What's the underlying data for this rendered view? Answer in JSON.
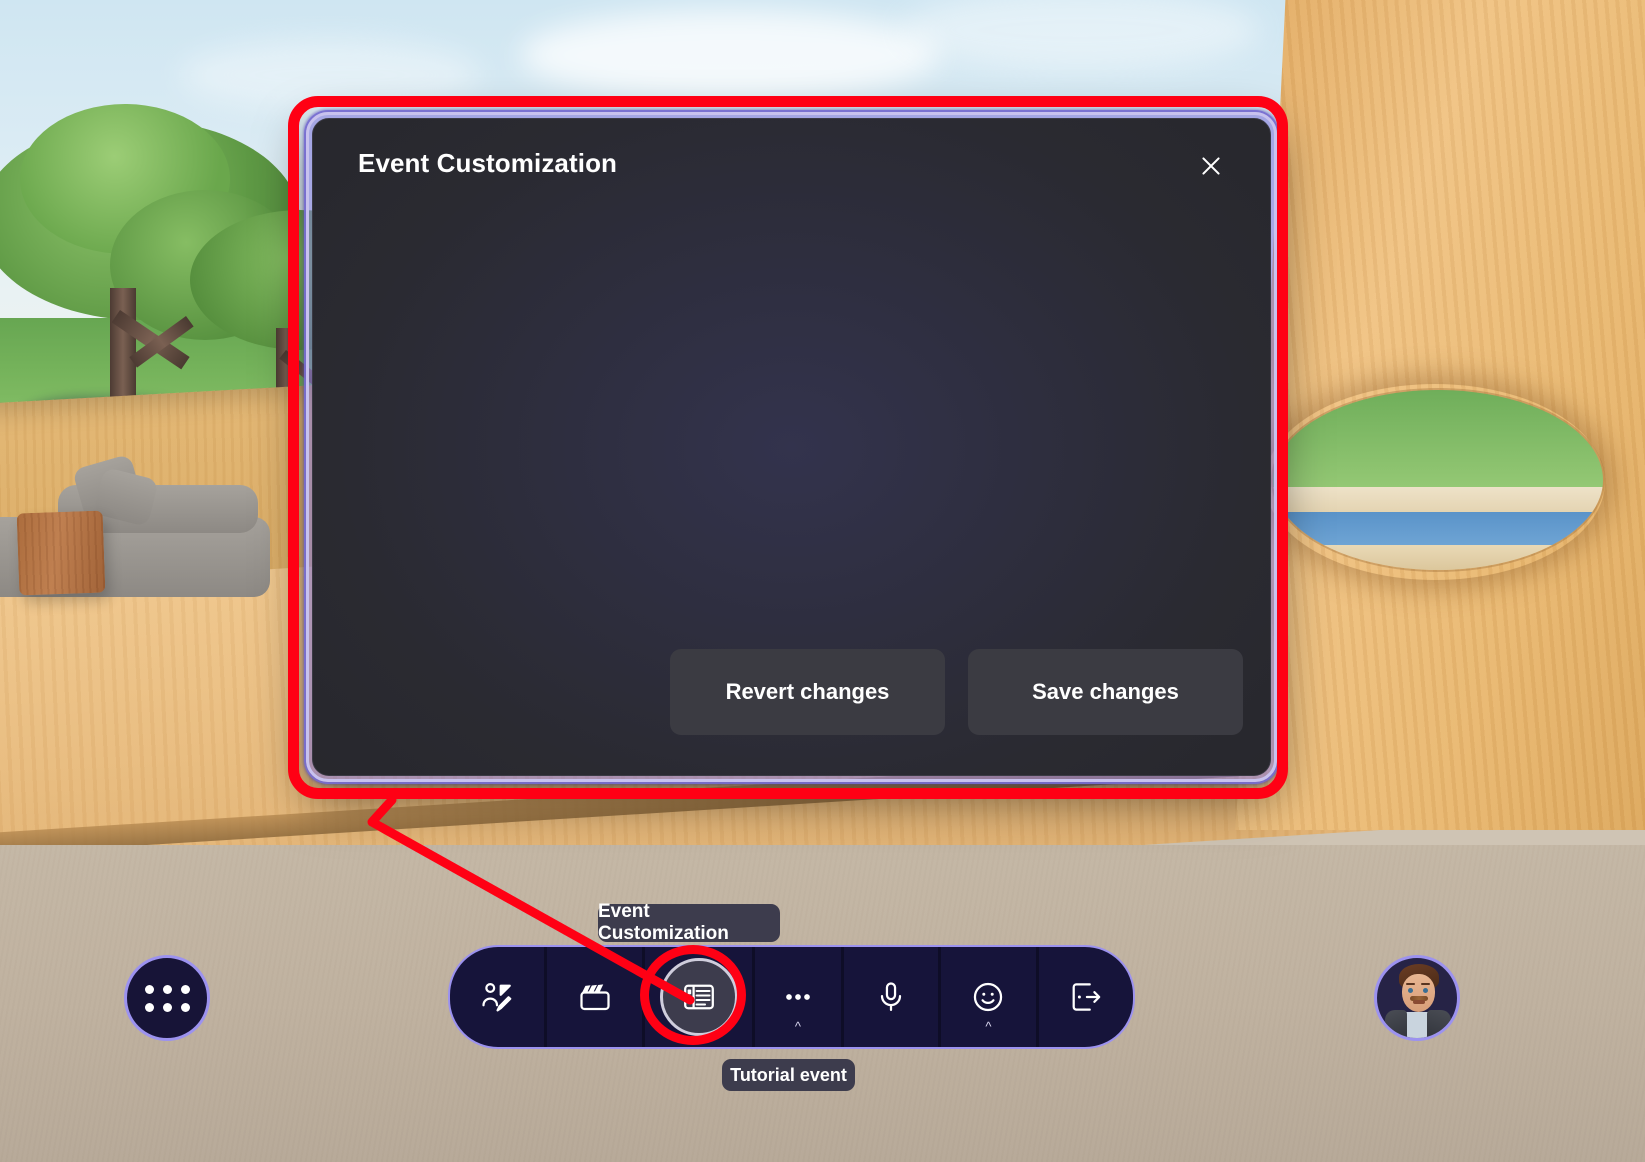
{
  "scene": {
    "description": "virtual-3d-meeting-room",
    "name": "virtual-room-background"
  },
  "dialog": {
    "title": "Event Customization",
    "close_icon": "close-x-icon",
    "buttons": {
      "revert": "Revert changes",
      "save": "Save changes"
    }
  },
  "annotations": {
    "highlight_color": "#ff0014",
    "rect_target": "event-customization-dialog",
    "ellipse_target": "event-customization-toolbar-button"
  },
  "tooltip": {
    "event_customization": "Event Customization"
  },
  "bottom_bar": {
    "apps_button": {
      "name": "apps-grid-button",
      "icon": "grid-dots-icon"
    },
    "toolbar_items": [
      {
        "name": "reactions",
        "icon": "reactions-icon",
        "has_chevron": false
      },
      {
        "name": "clapper",
        "icon": "clapper-board-icon",
        "has_chevron": false
      },
      {
        "name": "event-customization",
        "icon": "event-customization-icon",
        "has_chevron": false,
        "active": true
      },
      {
        "name": "more",
        "icon": "more-horizontal-icon",
        "has_chevron": true
      },
      {
        "name": "microphone",
        "icon": "microphone-icon",
        "has_chevron": false
      },
      {
        "name": "emoji",
        "icon": "smiley-icon",
        "has_chevron": true
      },
      {
        "name": "leave",
        "icon": "leave-call-icon",
        "has_chevron": false
      }
    ],
    "event_label": "Tutorial event",
    "avatar": {
      "name": "user-avatar",
      "icon": "avatar-icon"
    }
  },
  "colors": {
    "accent_purple": "#9c92ef",
    "toolbar_bg": "#16143a",
    "dialog_bg": "#2a2a31",
    "button_bg": "#3b3b42",
    "annotation_red": "#ff0014",
    "pill_bg": "#3d3c4d"
  }
}
